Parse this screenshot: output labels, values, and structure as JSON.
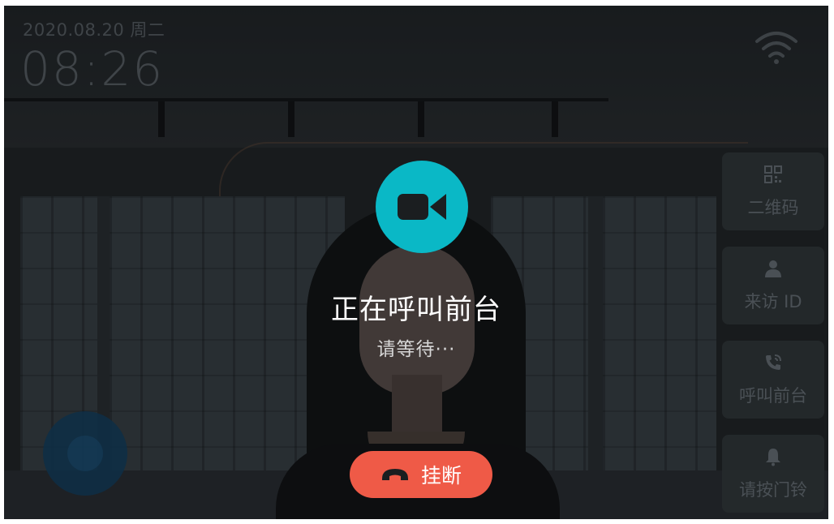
{
  "status": {
    "date": "2020.08.20  周二",
    "time": "08:26",
    "wifi_icon": "wifi-icon"
  },
  "call": {
    "icon": "video-camera-icon",
    "title": "正在呼叫前台",
    "subtitle": "请等待···",
    "hangup_label": "挂断",
    "hangup_icon": "phone-hangup-icon",
    "accent_color": "#0ab8c6",
    "hangup_color": "#ef5a47"
  },
  "side_menu": [
    {
      "label": "二维码",
      "icon": "qr-code-icon"
    },
    {
      "label": "来访 ID",
      "icon": "user-icon"
    },
    {
      "label": "呼叫前台",
      "icon": "phone-call-icon"
    },
    {
      "label": "请按门铃",
      "icon": "bell-icon"
    }
  ]
}
